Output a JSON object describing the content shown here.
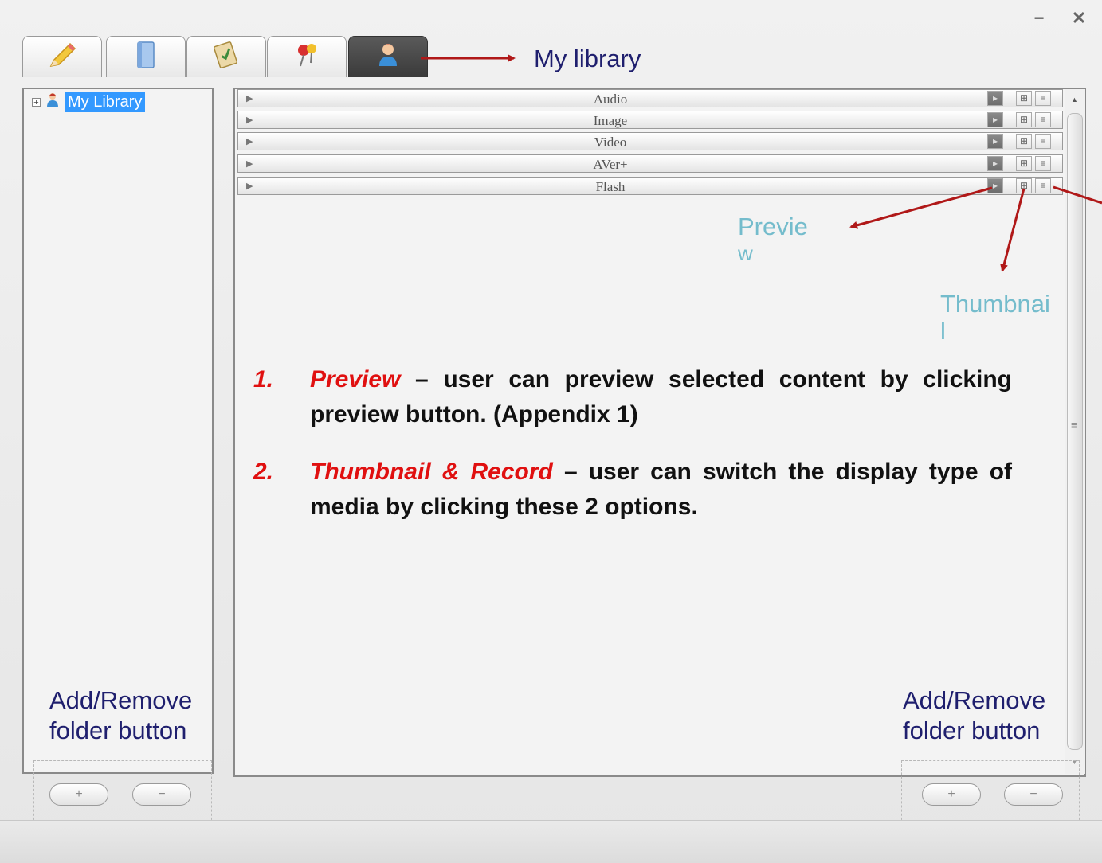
{
  "window": {
    "minimize_glyph": "−",
    "close_glyph": "✕",
    "tabs": [
      {
        "icon": "pencil-icon"
      },
      {
        "icon": "book-icon"
      },
      {
        "icon": "clipboard-icon"
      },
      {
        "icon": "pushpin-icon"
      },
      {
        "icon": "user-icon",
        "active": true
      }
    ]
  },
  "sidebar": {
    "tree": [
      {
        "label": "My Library",
        "icon": "user-icon",
        "expander": "+",
        "selected": true
      }
    ]
  },
  "media_rows": [
    {
      "label": "Audio"
    },
    {
      "label": "Image"
    },
    {
      "label": "Video"
    },
    {
      "label": "AVer+"
    },
    {
      "label": "Flash"
    }
  ],
  "row_buttons": {
    "preview": "▸",
    "thumbnail": "⊞",
    "record": "≡"
  },
  "scrollbar": {
    "up": "▲",
    "down": "▼",
    "grip": "≡"
  },
  "folder_buttons": {
    "add": "+",
    "remove": "−"
  },
  "annotations": {
    "my_library": "My library",
    "preview_line1": "Previe",
    "preview_line2": "w",
    "thumbnail_line1": "Thumbnai",
    "thumbnail_line2": "l",
    "add_remove_left_line1": "Add/Remove",
    "add_remove_left_line2": "folder button",
    "add_remove_right_line1": "Add/Remove",
    "add_remove_right_line2": "folder button"
  },
  "instructions": [
    {
      "num": "1.",
      "term": "Preview",
      "text": " – user can preview selected content by clicking preview button. (Appendix 1)"
    },
    {
      "num": "2.",
      "term": "Thumbnail & Record",
      "text": " – user can switch the display type of media by clicking these 2 options."
    }
  ],
  "colors": {
    "accent_red": "#e01010",
    "arrow_red": "#b01818",
    "selection_blue": "#3399ff",
    "annotation_navy": "#1f1f6e",
    "annotation_teal": "#74bccc"
  }
}
